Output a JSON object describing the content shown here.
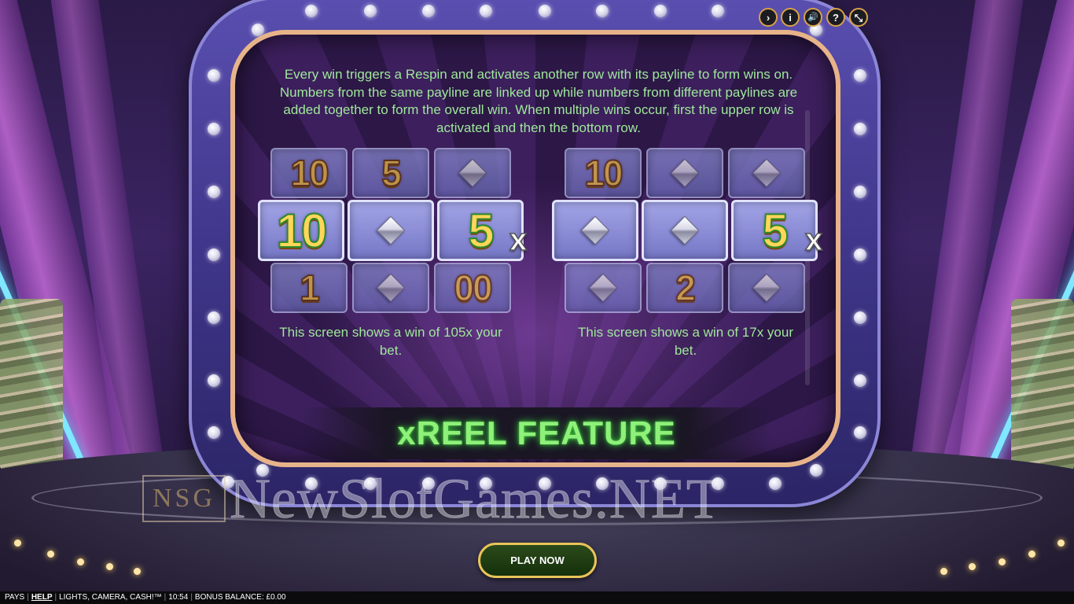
{
  "description": "Every win triggers a Respin and activates another row with its payline to form wins on. Numbers from the same payline are linked up while numbers from different paylines are added together to form the overall win. When multiple wins occur, first the upper row is activated and then the bottom row.",
  "example1": {
    "top": [
      "10",
      "5",
      "diamond"
    ],
    "middle": [
      "10",
      "diamond",
      "5"
    ],
    "bottom": [
      "1",
      "diamond",
      "00"
    ],
    "multiplier": "x",
    "caption": "This screen shows a win of 105x your bet."
  },
  "example2": {
    "top": [
      "10",
      "diamond",
      "diamond"
    ],
    "middle": [
      "diamond",
      "diamond",
      "5"
    ],
    "bottom": [
      "diamond",
      "2",
      "diamond"
    ],
    "multiplier": "x",
    "caption": "This screen shows a win of 17x your bet."
  },
  "banner_title": "xREEL FEATURE",
  "controls": {
    "next": "›",
    "info": "i",
    "sound": "🔊",
    "help": "?",
    "fullscreen": "⤡"
  },
  "watermark": {
    "logo": "NSG",
    "text": "NewSlotGames.NET"
  },
  "play_button": "PLAY NOW",
  "bottom_bar": {
    "pays": "PAYS",
    "help": "HELP",
    "game": "LIGHTS, CAMERA, CASH!™",
    "time": "10:54",
    "balance": "BONUS BALANCE: £0.00"
  },
  "colors": {
    "text_green": "#9fe89a",
    "banner_green": "#8ff07a",
    "frame_purple": "#4a40a0",
    "screen_border": "#e7b48a",
    "play_gold": "#e9c45a"
  }
}
